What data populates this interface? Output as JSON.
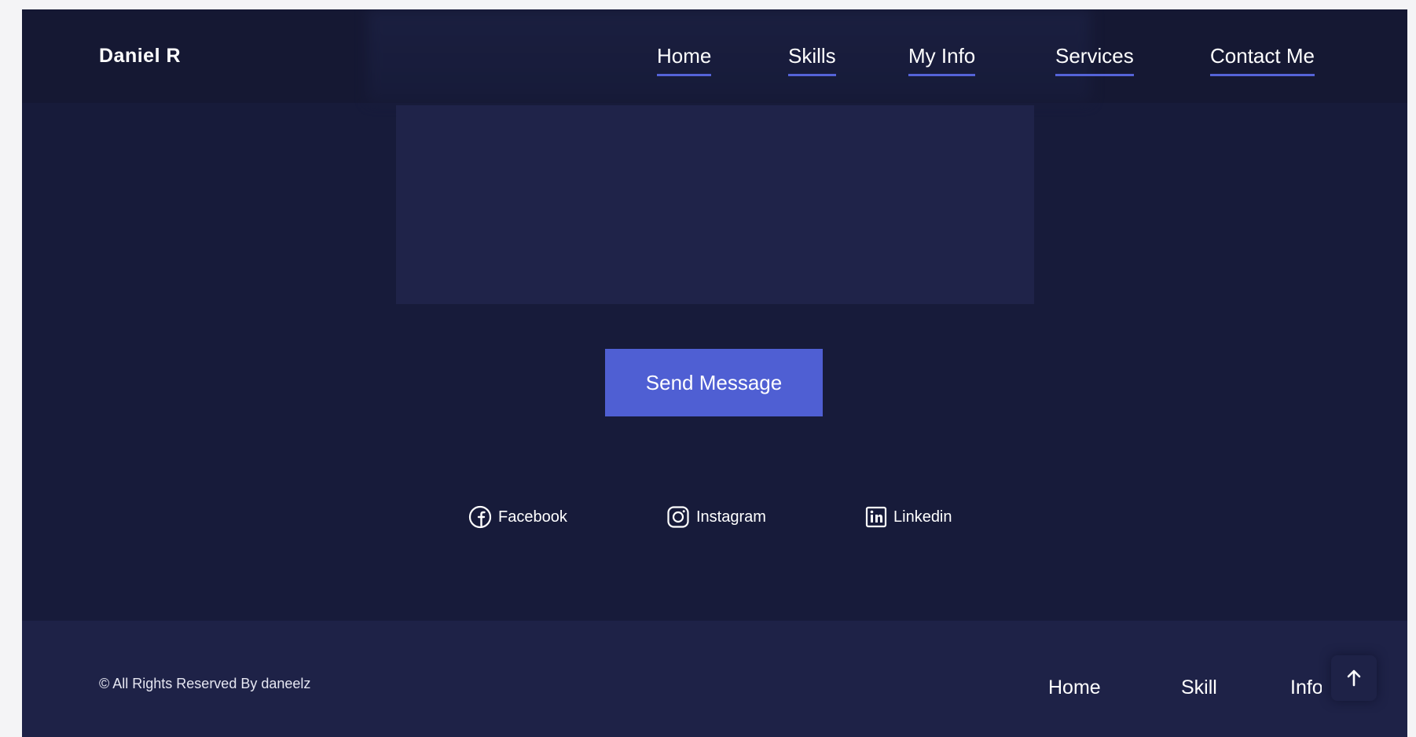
{
  "header": {
    "brand": "Daniel R",
    "nav": [
      "Home",
      "Skills",
      "My Info",
      "Services",
      "Contact Me"
    ]
  },
  "form": {
    "message_value": "",
    "send_label": "Send Message"
  },
  "social": [
    {
      "label": "Facebook",
      "icon": "facebook-icon"
    },
    {
      "label": "Instagram",
      "icon": "instagram-icon"
    },
    {
      "label": "Linkedin",
      "icon": "linkedin-icon"
    }
  ],
  "footer": {
    "copyright": "© All Rights Reserved By daneelz",
    "nav": [
      "Home",
      "Skill",
      "Info"
    ],
    "to_top_icon": "arrow-up-icon"
  },
  "colors": {
    "background": "#171b3a",
    "navbar": "#151833",
    "footer": "#1e2247",
    "accent": "#4f5fd3",
    "text": "#ffffff"
  }
}
